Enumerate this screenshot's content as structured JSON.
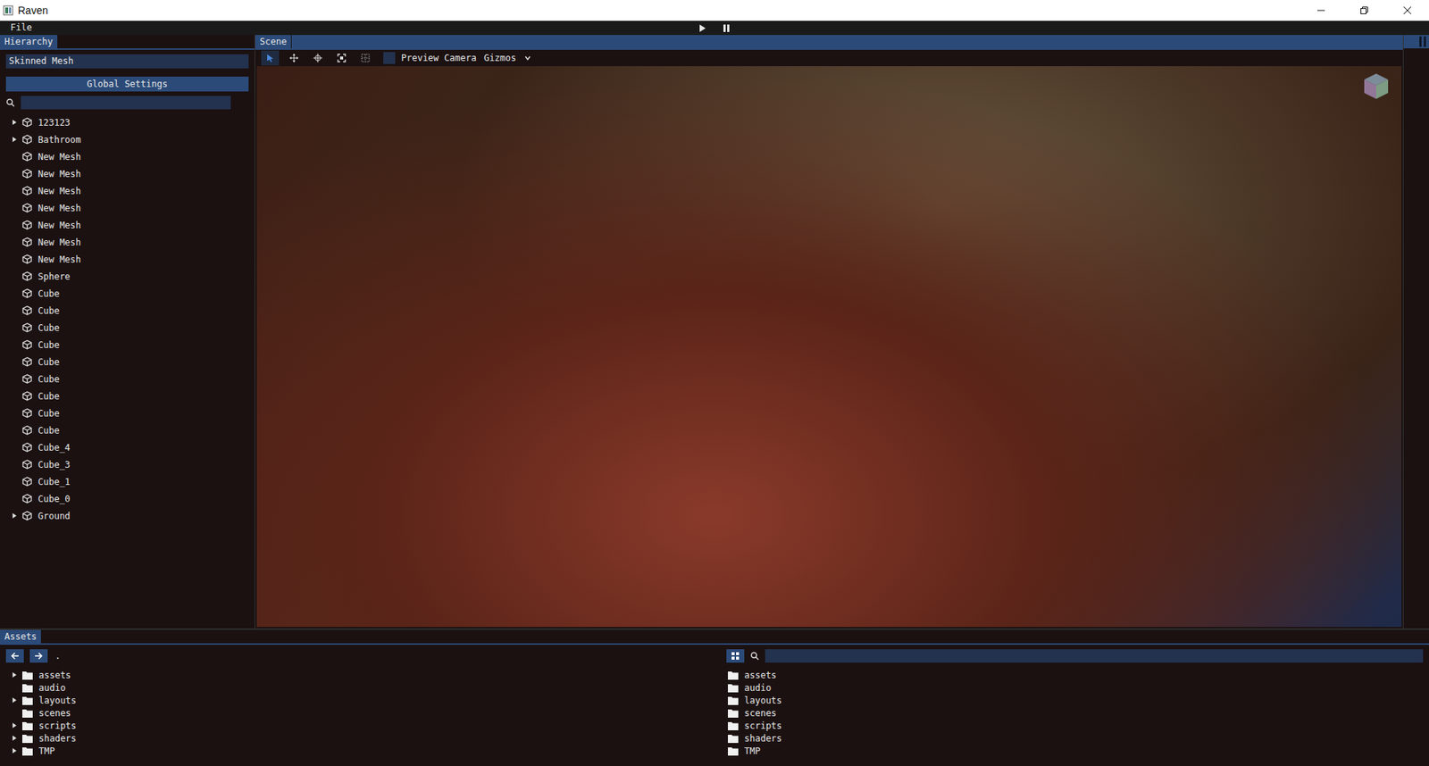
{
  "window": {
    "title": "Raven"
  },
  "menu": [
    "File"
  ],
  "playback": [
    {
      "kind": "play",
      "selected": false
    },
    {
      "kind": "pause",
      "selected": false
    }
  ],
  "hierarchy": {
    "tab": "Hierarchy",
    "name_field": "Skinned Mesh",
    "button": "Global Settings",
    "items": [
      {
        "name": "123123",
        "expandable": true
      },
      {
        "name": "Bathroom",
        "expandable": true
      },
      {
        "name": "New Mesh",
        "expandable": false
      },
      {
        "name": "New Mesh",
        "expandable": false
      },
      {
        "name": "New Mesh",
        "expandable": false
      },
      {
        "name": "New Mesh",
        "expandable": false
      },
      {
        "name": "New Mesh",
        "expandable": false
      },
      {
        "name": "New Mesh",
        "expandable": false
      },
      {
        "name": "New Mesh",
        "expandable": false
      },
      {
        "name": "Sphere",
        "expandable": false
      },
      {
        "name": "Cube",
        "expandable": false
      },
      {
        "name": "Cube",
        "expandable": false
      },
      {
        "name": "Cube",
        "expandable": false
      },
      {
        "name": "Cube",
        "expandable": false
      },
      {
        "name": "Cube",
        "expandable": false
      },
      {
        "name": "Cube",
        "expandable": false
      },
      {
        "name": "Cube",
        "expandable": false
      },
      {
        "name": "Cube",
        "expandable": false
      },
      {
        "name": "Cube",
        "expandable": false
      },
      {
        "name": "Cube_4",
        "expandable": false
      },
      {
        "name": "Cube_3",
        "expandable": false
      },
      {
        "name": "Cube_1",
        "expandable": false
      },
      {
        "name": "Cube_0",
        "expandable": false
      },
      {
        "name": "Ground",
        "expandable": true
      }
    ]
  },
  "scene": {
    "tab": "Scene",
    "tools": [
      {
        "kind": "select",
        "selected": true
      },
      {
        "kind": "move",
        "selected": false
      },
      {
        "kind": "rotate",
        "selected": false
      },
      {
        "kind": "scale",
        "selected": false
      },
      {
        "kind": "grid",
        "selected": false
      }
    ],
    "preview_camera": {
      "label": "Preview Camera",
      "checked": false
    },
    "gizmos": {
      "label": "Gizmos"
    }
  },
  "assets": {
    "tab": "Assets",
    "path": ".",
    "tree": [
      {
        "name": "assets",
        "expandable": true
      },
      {
        "name": "audio",
        "expandable": false
      },
      {
        "name": "layouts",
        "expandable": true
      },
      {
        "name": "scenes",
        "expandable": false
      },
      {
        "name": "scripts",
        "expandable": true
      },
      {
        "name": "shaders",
        "expandable": true
      },
      {
        "name": "TMP",
        "expandable": true
      }
    ],
    "files": [
      "assets",
      "audio",
      "layouts",
      "scenes",
      "scripts",
      "shaders",
      "TMP"
    ]
  }
}
